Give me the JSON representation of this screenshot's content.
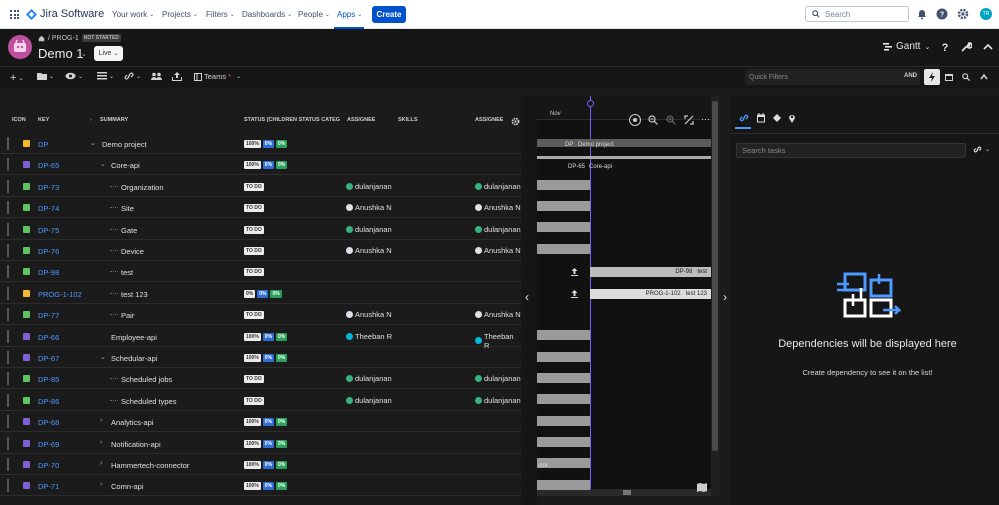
{
  "topnav": {
    "brand": "Jira Software",
    "menus": [
      "Your work",
      "Projects",
      "Filters",
      "Dashboards",
      "People",
      "Apps"
    ],
    "create": "Create",
    "search_placeholder": "Search",
    "user_initials": "TR"
  },
  "header": {
    "breadcrumb": "/ PROG-1",
    "status_tag": "NOT STARTED",
    "title": "Demo 1",
    "mode": "Live",
    "view": "Gantt"
  },
  "toolbar": {
    "teams": "Teams",
    "teams_star": "*",
    "quick_filters": "Quick Filters",
    "and": "AND"
  },
  "columns": {
    "icon": "ICON",
    "key": "KEY",
    "summary": "SUMMARY",
    "status": "STATUS [CHILDREN STATUS CATEG",
    "assignee": "ASSIGNEE",
    "skills": "SKILLS",
    "assignee2": "ASSIGNEE"
  },
  "rows": [
    {
      "key": "DP",
      "summary": "Demo project",
      "status": [
        "100%",
        "0%",
        "0%"
      ],
      "assignee": "",
      "assignee2": "",
      "type": "epic"
    },
    {
      "key": "DP-65",
      "summary": "Core-api",
      "status": [
        "100%",
        "0%",
        "0%"
      ],
      "assignee": "",
      "assignee2": "",
      "type": "story"
    },
    {
      "key": "DP-73",
      "summary": "Organization",
      "status": [
        "TO DO"
      ],
      "assignee": "dulanjanan",
      "assignee2": "dulanjanan",
      "type": "task"
    },
    {
      "key": "DP-74",
      "summary": "Site",
      "status": [
        "TO DO"
      ],
      "assignee": "Anushka N",
      "assignee2": "Anushka N",
      "type": "task"
    },
    {
      "key": "DP-75",
      "summary": "Gate",
      "status": [
        "TO DO"
      ],
      "assignee": "dulanjanan",
      "assignee2": "dulanjanan",
      "type": "task"
    },
    {
      "key": "DP-76",
      "summary": "Device",
      "status": [
        "TO DO"
      ],
      "assignee": "Anushka N",
      "assignee2": "Anushka N",
      "type": "task"
    },
    {
      "key": "DP-98",
      "summary": "test",
      "status": [
        "TO DO"
      ],
      "assignee": "",
      "assignee2": "",
      "type": "task"
    },
    {
      "key": "PROG-1-102",
      "summary": "test 123",
      "status": [
        "0%",
        "0%",
        "0%"
      ],
      "assignee": "",
      "assignee2": "",
      "type": "epic"
    },
    {
      "key": "DP-77",
      "summary": "Pair",
      "status": [
        "TO DO"
      ],
      "assignee": "Anushka N",
      "assignee2": "Anushka N",
      "type": "task"
    },
    {
      "key": "DP-66",
      "summary": "Employee-api",
      "status": [
        "100%",
        "0%",
        "0%"
      ],
      "assignee": "Theeban R",
      "assignee2": "Theeban R",
      "type": "story"
    },
    {
      "key": "DP-67",
      "summary": "Schedular-api",
      "status": [
        "100%",
        "0%",
        "0%"
      ],
      "assignee": "",
      "assignee2": "",
      "type": "story"
    },
    {
      "key": "DP-85",
      "summary": "Scheduled jobs",
      "status": [
        "TO DO"
      ],
      "assignee": "dulanjanan",
      "assignee2": "dulanjanan",
      "type": "task"
    },
    {
      "key": "DP-86",
      "summary": "Scheduled types",
      "status": [
        "TO DO"
      ],
      "assignee": "dulanjanan",
      "assignee2": "dulanjanan",
      "type": "task"
    },
    {
      "key": "DP-68",
      "summary": "Analytics-api",
      "status": [
        "100%",
        "0%",
        "0%"
      ],
      "assignee": "",
      "assignee2": "",
      "type": "story"
    },
    {
      "key": "DP-69",
      "summary": "Notification-api",
      "status": [
        "100%",
        "0%",
        "0%"
      ],
      "assignee": "",
      "assignee2": "",
      "type": "story"
    },
    {
      "key": "DP-70",
      "summary": "Hammertech-connector",
      "status": [
        "100%",
        "0%",
        "0%"
      ],
      "assignee": "",
      "assignee2": "",
      "type": "story"
    },
    {
      "key": "DP-71",
      "summary": "Comn-api",
      "status": [
        "100%",
        "0%",
        "0%"
      ],
      "assignee": "",
      "assignee2": "",
      "type": "story"
    }
  ],
  "gantt": {
    "month": "Nov",
    "labels": {
      "dp": "DP",
      "dp_name": "Demo project",
      "dp65": "DP-65",
      "dp65_name": "Core-api",
      "dp98": "DP-98",
      "dp98_name": "test",
      "p102": "PROG-1-102",
      "p102_name": "test 123",
      "ctor": "ctor"
    }
  },
  "right_panel": {
    "search_placeholder": "Search tasks",
    "title": "Dependencies will be displayed here",
    "subtitle": "Create dependency to see it on the list!"
  },
  "colors": {
    "accent": "#0052cc",
    "story": "#7f5fd1",
    "task": "#5fc35f",
    "epic": "#f5b82e",
    "key": "#4c9aff"
  }
}
